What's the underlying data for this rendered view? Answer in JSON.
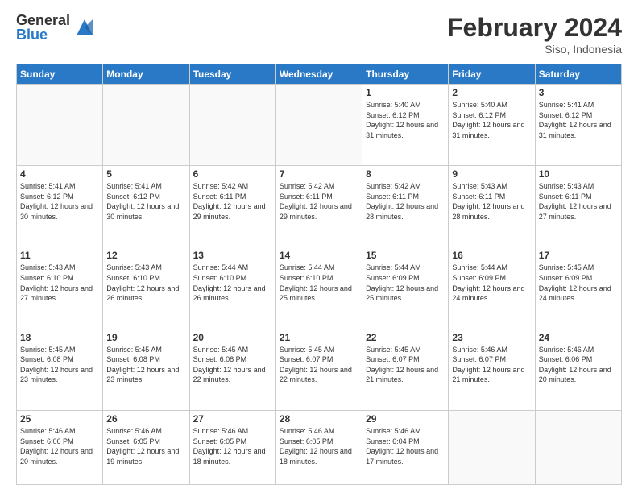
{
  "header": {
    "logo_general": "General",
    "logo_blue": "Blue",
    "month_title": "February 2024",
    "location": "Siso, Indonesia"
  },
  "days_of_week": [
    "Sunday",
    "Monday",
    "Tuesday",
    "Wednesday",
    "Thursday",
    "Friday",
    "Saturday"
  ],
  "weeks": [
    [
      {
        "day": "",
        "info": ""
      },
      {
        "day": "",
        "info": ""
      },
      {
        "day": "",
        "info": ""
      },
      {
        "day": "",
        "info": ""
      },
      {
        "day": "1",
        "info": "Sunrise: 5:40 AM\nSunset: 6:12 PM\nDaylight: 12 hours\nand 31 minutes."
      },
      {
        "day": "2",
        "info": "Sunrise: 5:40 AM\nSunset: 6:12 PM\nDaylight: 12 hours\nand 31 minutes."
      },
      {
        "day": "3",
        "info": "Sunrise: 5:41 AM\nSunset: 6:12 PM\nDaylight: 12 hours\nand 31 minutes."
      }
    ],
    [
      {
        "day": "4",
        "info": "Sunrise: 5:41 AM\nSunset: 6:12 PM\nDaylight: 12 hours\nand 30 minutes."
      },
      {
        "day": "5",
        "info": "Sunrise: 5:41 AM\nSunset: 6:12 PM\nDaylight: 12 hours\nand 30 minutes."
      },
      {
        "day": "6",
        "info": "Sunrise: 5:42 AM\nSunset: 6:11 PM\nDaylight: 12 hours\nand 29 minutes."
      },
      {
        "day": "7",
        "info": "Sunrise: 5:42 AM\nSunset: 6:11 PM\nDaylight: 12 hours\nand 29 minutes."
      },
      {
        "day": "8",
        "info": "Sunrise: 5:42 AM\nSunset: 6:11 PM\nDaylight: 12 hours\nand 28 minutes."
      },
      {
        "day": "9",
        "info": "Sunrise: 5:43 AM\nSunset: 6:11 PM\nDaylight: 12 hours\nand 28 minutes."
      },
      {
        "day": "10",
        "info": "Sunrise: 5:43 AM\nSunset: 6:11 PM\nDaylight: 12 hours\nand 27 minutes."
      }
    ],
    [
      {
        "day": "11",
        "info": "Sunrise: 5:43 AM\nSunset: 6:10 PM\nDaylight: 12 hours\nand 27 minutes."
      },
      {
        "day": "12",
        "info": "Sunrise: 5:43 AM\nSunset: 6:10 PM\nDaylight: 12 hours\nand 26 minutes."
      },
      {
        "day": "13",
        "info": "Sunrise: 5:44 AM\nSunset: 6:10 PM\nDaylight: 12 hours\nand 26 minutes."
      },
      {
        "day": "14",
        "info": "Sunrise: 5:44 AM\nSunset: 6:10 PM\nDaylight: 12 hours\nand 25 minutes."
      },
      {
        "day": "15",
        "info": "Sunrise: 5:44 AM\nSunset: 6:09 PM\nDaylight: 12 hours\nand 25 minutes."
      },
      {
        "day": "16",
        "info": "Sunrise: 5:44 AM\nSunset: 6:09 PM\nDaylight: 12 hours\nand 24 minutes."
      },
      {
        "day": "17",
        "info": "Sunrise: 5:45 AM\nSunset: 6:09 PM\nDaylight: 12 hours\nand 24 minutes."
      }
    ],
    [
      {
        "day": "18",
        "info": "Sunrise: 5:45 AM\nSunset: 6:08 PM\nDaylight: 12 hours\nand 23 minutes."
      },
      {
        "day": "19",
        "info": "Sunrise: 5:45 AM\nSunset: 6:08 PM\nDaylight: 12 hours\nand 23 minutes."
      },
      {
        "day": "20",
        "info": "Sunrise: 5:45 AM\nSunset: 6:08 PM\nDaylight: 12 hours\nand 22 minutes."
      },
      {
        "day": "21",
        "info": "Sunrise: 5:45 AM\nSunset: 6:07 PM\nDaylight: 12 hours\nand 22 minutes."
      },
      {
        "day": "22",
        "info": "Sunrise: 5:45 AM\nSunset: 6:07 PM\nDaylight: 12 hours\nand 21 minutes."
      },
      {
        "day": "23",
        "info": "Sunrise: 5:46 AM\nSunset: 6:07 PM\nDaylight: 12 hours\nand 21 minutes."
      },
      {
        "day": "24",
        "info": "Sunrise: 5:46 AM\nSunset: 6:06 PM\nDaylight: 12 hours\nand 20 minutes."
      }
    ],
    [
      {
        "day": "25",
        "info": "Sunrise: 5:46 AM\nSunset: 6:06 PM\nDaylight: 12 hours\nand 20 minutes."
      },
      {
        "day": "26",
        "info": "Sunrise: 5:46 AM\nSunset: 6:05 PM\nDaylight: 12 hours\nand 19 minutes."
      },
      {
        "day": "27",
        "info": "Sunrise: 5:46 AM\nSunset: 6:05 PM\nDaylight: 12 hours\nand 18 minutes."
      },
      {
        "day": "28",
        "info": "Sunrise: 5:46 AM\nSunset: 6:05 PM\nDaylight: 12 hours\nand 18 minutes."
      },
      {
        "day": "29",
        "info": "Sunrise: 5:46 AM\nSunset: 6:04 PM\nDaylight: 12 hours\nand 17 minutes."
      },
      {
        "day": "",
        "info": ""
      },
      {
        "day": "",
        "info": ""
      }
    ]
  ]
}
